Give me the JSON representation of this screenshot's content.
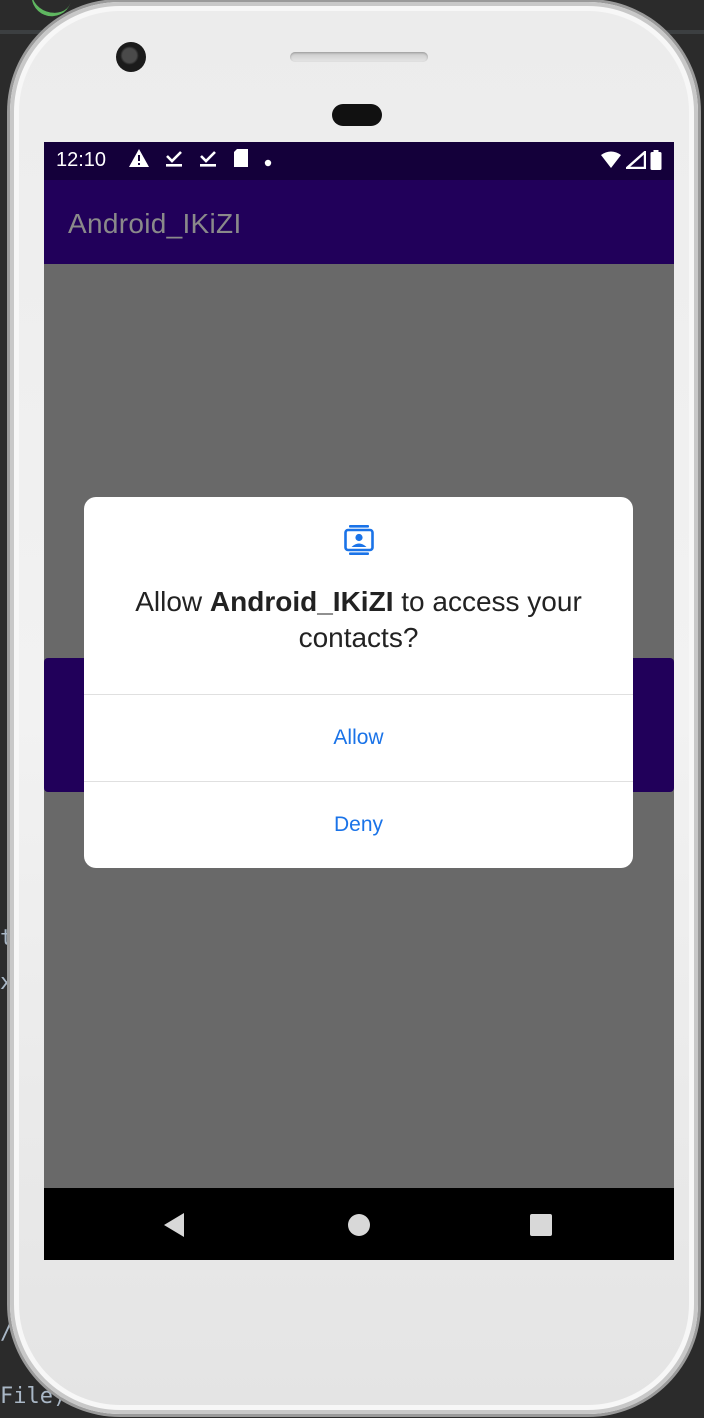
{
  "colors": {
    "status_bar": "#14003a",
    "app_bar": "#21005a",
    "scrim": "#696969",
    "dialog_bg": "#ffffff",
    "button_text": "#1a73e8"
  },
  "background": {
    "fragment_t": "t",
    "fragment_x": "x",
    "fragment_slash": "/",
    "fragment_file": "File)"
  },
  "status_bar": {
    "time": "12:10",
    "left_icons": [
      "warning-icon",
      "download-done-icon",
      "download-done-icon",
      "sd-card-icon",
      "dot-icon"
    ],
    "right_icons": [
      "wifi-icon",
      "signal-icon",
      "battery-icon"
    ]
  },
  "app_bar": {
    "title": "Android_IKiZI"
  },
  "dialog": {
    "icon": "contacts-icon",
    "message_prefix": "Allow ",
    "app_name": "Android_IKiZI",
    "message_suffix": " to access your contacts?",
    "allow_label": "Allow",
    "deny_label": "Deny"
  },
  "nav_bar": {
    "icons": [
      "back-icon",
      "home-icon",
      "recents-icon"
    ]
  }
}
